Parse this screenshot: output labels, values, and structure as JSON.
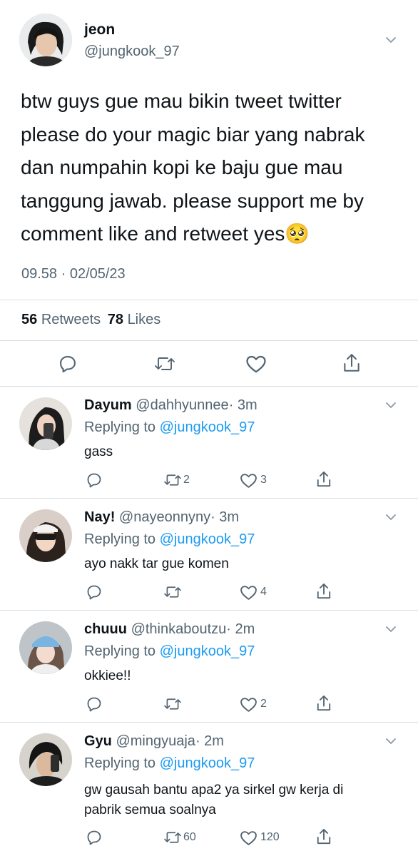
{
  "main_tweet": {
    "name": "jeon",
    "handle": "@jungkook_97",
    "text_lines": [
      "btw guys gue mau bikin tweet twitter",
      "please do your magic biar yang nabrak",
      "dan numpahin kopi ke baju gue mau",
      "tanggung jawab. please support me by",
      "comment like and retweet yes🥺"
    ],
    "timestamp": "09.58 · 02/05/23",
    "retweet_count": "56",
    "retweet_label": "Retweets",
    "like_count": "78",
    "like_label": "Likes"
  },
  "replies": [
    {
      "name": "Dayum",
      "handle": "@dahhyunnee",
      "time": "· 3m",
      "replying_label": "Replying to",
      "replying_handle": "@jungkook_97",
      "text_lines": [
        "gass"
      ],
      "retweets": "2",
      "likes": "3"
    },
    {
      "name": "Nay!",
      "handle": "@nayeonnyny",
      "time": "· 3m",
      "replying_label": "Replying to",
      "replying_handle": "@jungkook_97",
      "text_lines": [
        "ayo nakk tar gue komen"
      ],
      "retweets": "",
      "likes": "4"
    },
    {
      "name": "chuuu",
      "handle": "@thinkaboutzu",
      "time": "· 2m",
      "replying_label": "Replying to",
      "replying_handle": "@jungkook_97",
      "text_lines": [
        "okkiee!!"
      ],
      "retweets": "",
      "likes": "2"
    },
    {
      "name": "Gyu",
      "handle": "@mingyuaja",
      "time": "· 2m",
      "replying_label": "Replying to",
      "replying_handle": "@jungkook_97",
      "text_lines": [
        "gw gausah bantu apa2 ya sirkel gw kerja di",
        "pabrik semua soalnya"
      ],
      "retweets": "60",
      "likes": "120"
    }
  ],
  "icons": {
    "reply": "reply-icon",
    "retweet": "retweet-icon",
    "like": "like-icon",
    "share": "share-icon",
    "more": "chevron-down-icon"
  },
  "colors": {
    "accent": "#1d9bf0",
    "muted": "#536471",
    "divider": "#d9dde1"
  }
}
